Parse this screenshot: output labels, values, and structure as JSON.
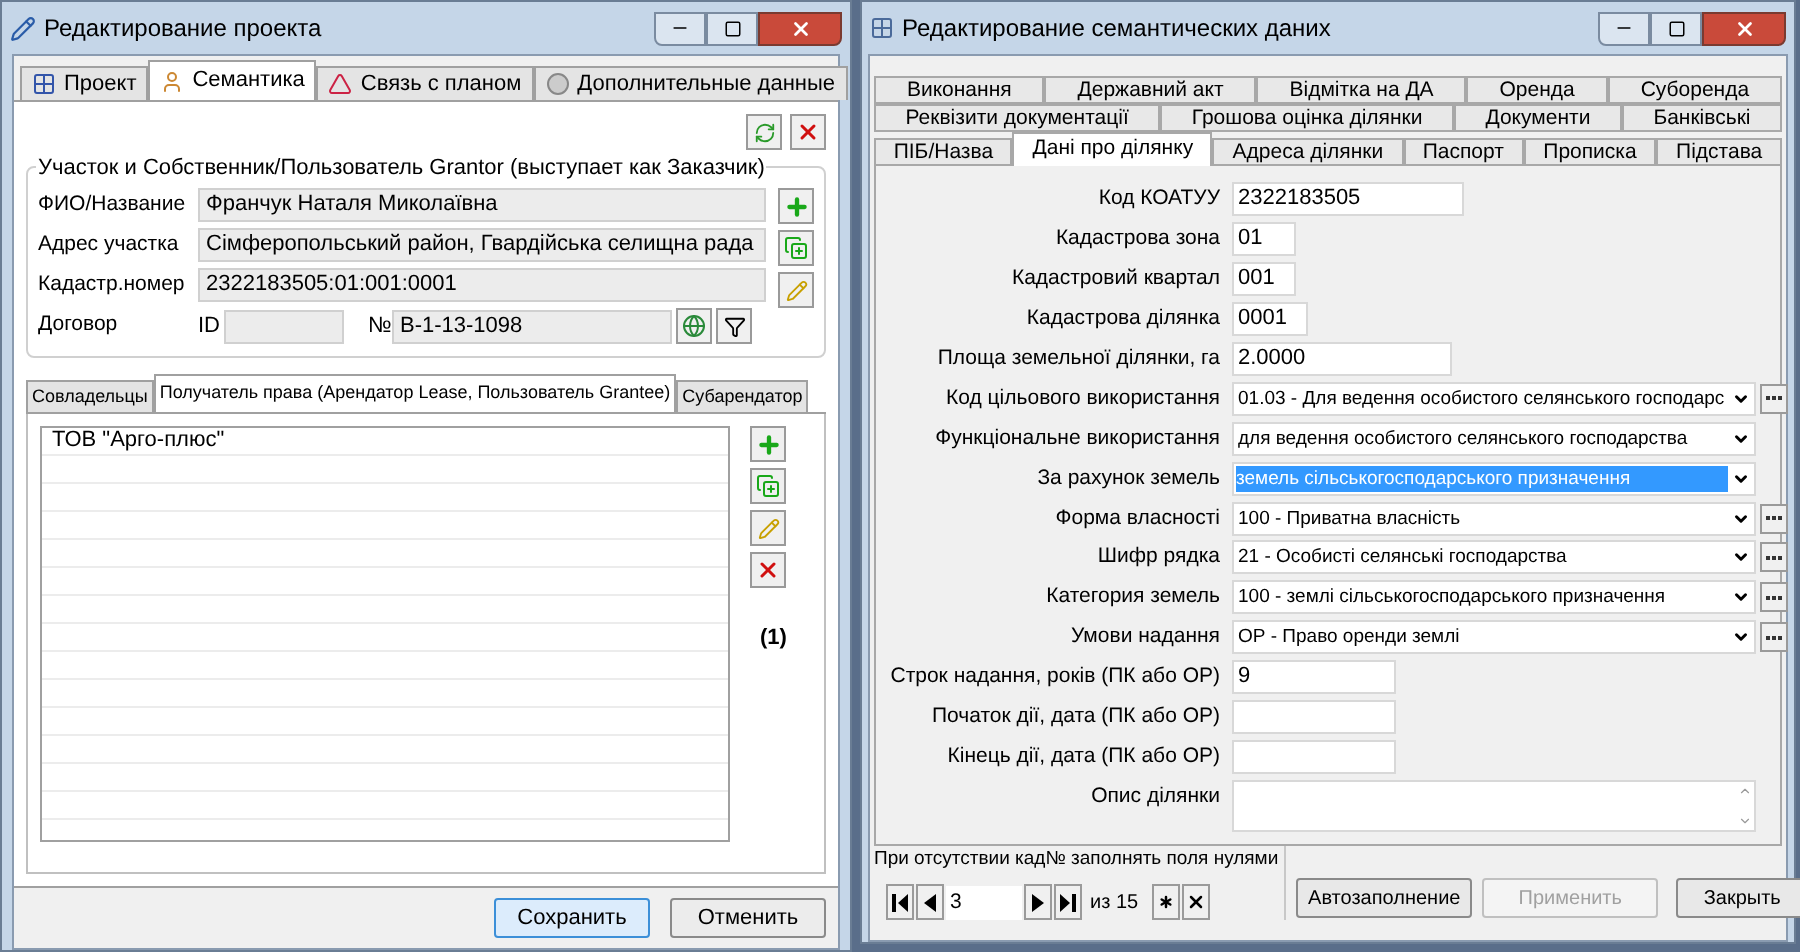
{
  "left": {
    "title": "Редактирование проекта",
    "tabs": [
      {
        "label": "Проект",
        "selected": false
      },
      {
        "label": "Семантика",
        "selected": true
      },
      {
        "label": "Связь с планом",
        "selected": false
      },
      {
        "label": "Дополнительные данные",
        "selected": false
      }
    ],
    "group_title": "Участок и Собственник/Пользователь Grantor (выступает как Заказчик)",
    "fields": [
      {
        "label": "ФИО/Название",
        "value": "Франчук Наталя Миколаївна"
      },
      {
        "label": "Адрес участка",
        "value": "Сімферопольський район, Гвардійська селищна рада"
      },
      {
        "label": "Кадастр.номер",
        "value": "2322183505:01:001:0001"
      }
    ],
    "contract": {
      "label": "Договор",
      "id_label": "ID",
      "number_label": "№",
      "number_value": "В-1-13-1098"
    },
    "subtabs": [
      {
        "label": "Совладельцы",
        "selected": false
      },
      {
        "label": "Получатель права (Арендатор Lease, Пользователь Grantee)",
        "selected": true
      },
      {
        "label": "Субарендатор",
        "selected": false
      }
    ],
    "rows": [
      "ТОВ \"Арго-плюс\""
    ],
    "count": "(1)",
    "buttons": [
      {
        "label": "Сохранить",
        "default": true
      },
      {
        "label": "Отменить",
        "default": false
      }
    ]
  },
  "right": {
    "title": "Редактирование семантических даних",
    "tab_rows": [
      [
        {
          "label": "Виконання",
          "selected": false
        },
        {
          "label": "Державний акт",
          "selected": false
        },
        {
          "label": "Відмітка на ДА",
          "selected": false
        },
        {
          "label": "Оренда",
          "selected": false
        },
        {
          "label": "Суборенда",
          "selected": false
        }
      ],
      [
        {
          "label": "Реквізити документації",
          "selected": false
        },
        {
          "label": "Грошова оцінка ділянки",
          "selected": false
        },
        {
          "label": "Документи",
          "selected": false
        },
        {
          "label": "Банківські",
          "selected": false
        }
      ],
      [
        {
          "label": "ПІБ/Назва",
          "selected": false
        },
        {
          "label": "Дані про ділянку",
          "selected": true
        },
        {
          "label": "Адреса ділянки",
          "selected": false
        },
        {
          "label": "Паспорт",
          "selected": false
        },
        {
          "label": "Прописка",
          "selected": false
        },
        {
          "label": "Підстава",
          "selected": false
        }
      ]
    ],
    "fields": [
      {
        "kind": "text",
        "label": "Код КОАТУУ",
        "value": "2322183505"
      },
      {
        "kind": "text",
        "label": "Кадастрова зона",
        "value": "01"
      },
      {
        "kind": "text",
        "label": "Кадастровий квартал",
        "value": "001"
      },
      {
        "kind": "text",
        "label": "Кадастрова ділянка",
        "value": "0001"
      },
      {
        "kind": "text",
        "label": "Площа земельної ділянки, га",
        "value": "2.0000"
      },
      {
        "kind": "select",
        "label": "Код цільового використання",
        "value": "01.03 - Для ведення особистого селянського господарс",
        "more": true,
        "highlighted": false
      },
      {
        "kind": "select",
        "label": "Функціональне використання",
        "value": "для ведення особистого селянського господарства",
        "more": false,
        "highlighted": false
      },
      {
        "kind": "select",
        "label": "За рахунок земель",
        "value": "земель сільськогосподарського призначення",
        "more": false,
        "highlighted": true
      },
      {
        "kind": "select",
        "label": "Форма власності",
        "value": "100 - Приватна власність",
        "more": true,
        "highlighted": false
      },
      {
        "kind": "select",
        "label": "Шифр рядка",
        "value": "21 - Особисті селянські господарства",
        "more": true,
        "highlighted": false
      },
      {
        "kind": "select",
        "label": "Категория земель",
        "value": "100 - землі сільськогосподарського призначення",
        "more": true,
        "highlighted": false
      },
      {
        "kind": "select",
        "label": "Умови надання",
        "value": "ОР - Право оренди землі",
        "more": true,
        "highlighted": false
      },
      {
        "kind": "text",
        "label": "Строк надання, років (ПК або ОР)",
        "value": "9"
      },
      {
        "kind": "text",
        "label": "Початок дії, дата (ПК або ОР)"
      },
      {
        "kind": "text",
        "label": "Кінець дії, дата (ПК або ОР)"
      },
      {
        "kind": "memo",
        "label": "Опис ділянки"
      }
    ],
    "hint": "При отсутствии кад№ заполнять поля нулями",
    "record": "3",
    "total": "из 15",
    "buttons": [
      {
        "label": "Автозаполнение",
        "disabled": false
      },
      {
        "label": "Применить",
        "disabled": true
      },
      {
        "label": "Закрыть",
        "disabled": false
      }
    ]
  }
}
